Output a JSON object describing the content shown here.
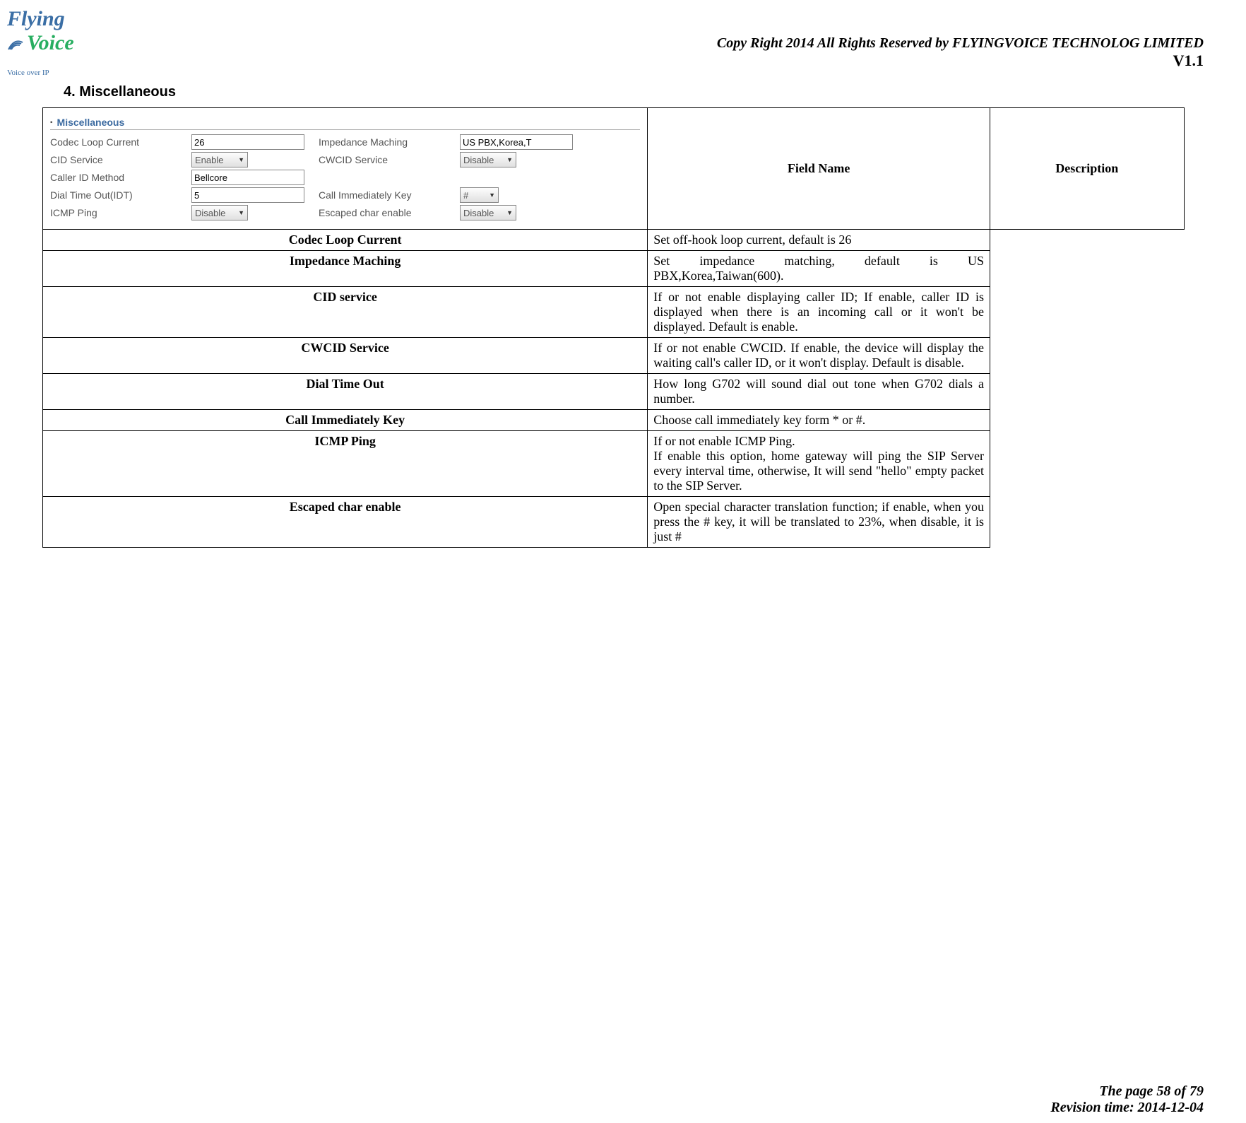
{
  "logo": {
    "brand1": "Flying",
    "brand2": "Voice",
    "tagline": "Voice over IP"
  },
  "header": {
    "copyright": "Copy Right 2014 All Rights Reserved by FLYINGVOICE TECHNOLOG LIMITED",
    "version": "V1.1"
  },
  "section": {
    "number": "4.",
    "title": "Miscellaneous"
  },
  "ui_pane": {
    "legend": "Miscellaneous",
    "rows": [
      {
        "l1": "Codec Loop Current",
        "v1": "26",
        "t1": "input",
        "l2": "Impedance Maching",
        "v2": "US PBX,Korea,T",
        "t2": "input"
      },
      {
        "l1": "CID Service",
        "v1": "Enable",
        "t1": "select",
        "l2": "CWCID Service",
        "v2": "Disable",
        "t2": "select"
      },
      {
        "l1": "Caller ID Method",
        "v1": "Bellcore",
        "t1": "input",
        "l2": "",
        "v2": "",
        "t2": ""
      },
      {
        "l1": "Dial Time Out(IDT)",
        "v1": "5",
        "t1": "input",
        "l2": "Call Immediately Key",
        "v2": "#",
        "t2": "select-tiny"
      },
      {
        "l1": "ICMP Ping",
        "v1": "Disable",
        "t1": "select",
        "l2": "Escaped char enable",
        "v2": "Disable",
        "t2": "select"
      }
    ]
  },
  "table": {
    "header": {
      "field": "Field Name",
      "desc": "Description"
    },
    "rows": [
      {
        "field": "Codec Loop Current",
        "desc": "Set off-hook loop current, default is 26"
      },
      {
        "field": "Impedance Maching",
        "desc": "Set impedance matching, default is US PBX,Korea,Taiwan(600)."
      },
      {
        "field": "CID service",
        "desc": "If or not enable displaying caller ID; If enable, caller ID is displayed when there is an incoming call or it won't be displayed. Default is enable."
      },
      {
        "field": "CWCID Service",
        "desc": "If or not enable CWCID. If enable, the device will display the waiting call's caller ID, or it won't display. Default is disable."
      },
      {
        "field": "Dial Time Out",
        "desc": "How long G702 will sound dial out tone when G702 dials a number."
      },
      {
        "field": "Call Immediately Key",
        "desc": "Choose call immediately key form * or #."
      },
      {
        "field": "ICMP Ping",
        "desc": "If or not enable ICMP Ping.\nIf enable this option, home gateway will ping the SIP Server every interval time, otherwise, It will send \"hello\" empty packet to the SIP Server."
      },
      {
        "field": "Escaped char enable",
        "desc": "Open special character translation function; if enable, when you press the # key, it will be translated to 23%, when disable, it is just #"
      }
    ]
  },
  "footer": {
    "page": "The page 58 of 79",
    "revision": "Revision time: 2014-12-04"
  }
}
